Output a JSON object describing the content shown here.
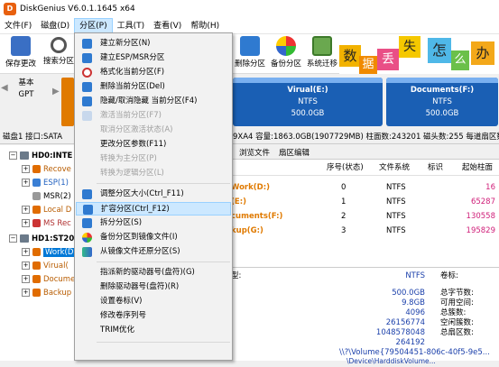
{
  "window": {
    "title": "DiskGenius V6.0.1.1645 x64"
  },
  "menubar": [
    "文件(F)",
    "磁盘(D)",
    "分区(P)",
    "工具(T)",
    "查看(V)",
    "帮助(H)"
  ],
  "toolbar": [
    "保存更改",
    "搜索分区",
    "删除分区",
    "备份分区",
    "系统迁移"
  ],
  "banner": {
    "chars": [
      "数",
      "据",
      "丢",
      "失",
      "怎",
      "么",
      "办"
    ]
  },
  "diskmap": {
    "basic": "基本",
    "gpt": "GPT",
    "partitions": [
      {
        "name": "Virual(E:)",
        "fs": "NTFS",
        "size": "500.0GB"
      },
      {
        "name": "Documents(F:)",
        "fs": "NTFS",
        "size": "500.0GB"
      }
    ]
  },
  "diskinfo": {
    "left": "磁盘1 接口:SATA",
    "right": "9XA4  容量:1863.0GB(1907729MB)  柱面数:243201  磁头数:255  每道扇区数:63"
  },
  "tree": {
    "disk0": "HD0:INTE",
    "disk0_parts": [
      "Recove",
      "ESP(1)",
      "MSR(2)",
      "Local D",
      "MS Rec"
    ],
    "disk1": "HD1:ST200",
    "disk1_parts": [
      "Work(D",
      "Virual(",
      "Docume",
      "Backup"
    ]
  },
  "tabs": [
    "浏览文件",
    "扇区编辑"
  ],
  "grid": {
    "headers": [
      "序号(状态)",
      "文件系统",
      "标识",
      "起始柱面"
    ],
    "rows": [
      {
        "name": "Work(D:)",
        "idx": "0",
        "fs": "NTFS",
        "start": "16"
      },
      {
        "name": "(E:)",
        "idx": "1",
        "fs": "NTFS",
        "start": "65287"
      },
      {
        "name": "cuments(F:)",
        "idx": "2",
        "fs": "NTFS",
        "start": "130558"
      },
      {
        "name": "kup(G:)",
        "idx": "3",
        "fs": "NTFS",
        "start": "195829"
      }
    ]
  },
  "detail": {
    "left_labels": [
      "型:",
      "",
      "",
      "",
      "",
      "",
      "",
      "",
      "",
      ""
    ],
    "values": [
      "NTFS",
      "500.0GB",
      "9.8GB",
      "4096",
      "26156774",
      "1048578048",
      "264192",
      "\\\\?\\Volume{79504451-806c-40f5-9e5...",
      "\\Device\\HarddiskVolume..."
    ],
    "labels": [
      "卷标:",
      "总字节数:",
      "可用空间:",
      "总簇数:",
      "空闲簇数:",
      "总扇区数:",
      "",
      "",
      ""
    ]
  },
  "menu": {
    "items": [
      {
        "label": "建立新分区(N)",
        "dis": false
      },
      {
        "label": "建立ESP/MSR分区",
        "dis": false
      },
      {
        "label": "格式化当前分区(F)",
        "dis": false
      },
      {
        "label": "删除当前分区(Del)",
        "dis": false
      },
      {
        "label": "隐藏/取消隐藏 当前分区(F4)",
        "dis": false
      },
      {
        "label": "激活当前分区(F7)",
        "dis": true
      },
      {
        "label": "取消分区激活状态(A)",
        "dis": true
      },
      {
        "label": "更改分区参数(F11)",
        "dis": false
      },
      {
        "label": "转换为主分区(P)",
        "dis": true
      },
      {
        "label": "转换为逻辑分区(L)",
        "dis": true
      },
      {
        "label": "调整分区大小(Ctrl_F11)",
        "dis": false
      },
      {
        "label": "扩容分区(Ctrl_F12)",
        "dis": false
      },
      {
        "label": "拆分分区(S)",
        "dis": false
      },
      {
        "label": "备份分区到镜像文件(I)",
        "dis": false
      },
      {
        "label": "从镜像文件还原分区(S)",
        "dis": false
      },
      {
        "label": "指派新的驱动器号(盘符)(G)",
        "dis": false
      },
      {
        "label": "删除驱动器号(盘符)(R)",
        "dis": false
      },
      {
        "label": "设置卷标(V)",
        "dis": false
      },
      {
        "label": "修改卷序列号",
        "dis": false
      },
      {
        "label": "TRIM优化",
        "dis": false
      }
    ]
  }
}
